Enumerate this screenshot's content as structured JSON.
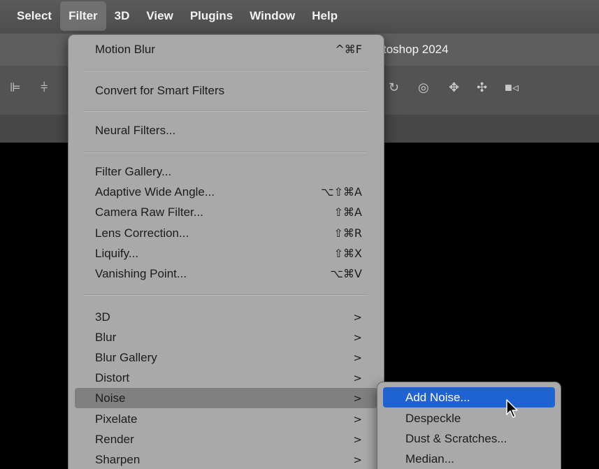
{
  "menubar": {
    "items": [
      "Select",
      "Filter",
      "3D",
      "View",
      "Plugins",
      "Window",
      "Help"
    ],
    "active": "Filter"
  },
  "app": {
    "title_fragment": "toshop 2024"
  },
  "filter_menu": {
    "motion_blur": {
      "label": "Motion Blur",
      "shortcut": "^⌘F"
    },
    "convert_smart": {
      "label": "Convert for Smart Filters"
    },
    "neural": {
      "label": "Neural Filters..."
    },
    "filter_gallery": {
      "label": "Filter Gallery..."
    },
    "adaptive_wide": {
      "label": "Adaptive Wide Angle...",
      "shortcut": "⌥⇧⌘A"
    },
    "camera_raw": {
      "label": "Camera Raw Filter...",
      "shortcut": "⇧⌘A"
    },
    "lens_correction": {
      "label": "Lens Correction...",
      "shortcut": "⇧⌘R"
    },
    "liquify": {
      "label": "Liquify...",
      "shortcut": "⇧⌘X"
    },
    "vanishing_point": {
      "label": "Vanishing Point...",
      "shortcut": "⌥⌘V"
    },
    "sub_3d": {
      "label": "3D"
    },
    "blur": {
      "label": "Blur"
    },
    "blur_gallery": {
      "label": "Blur Gallery"
    },
    "distort": {
      "label": "Distort"
    },
    "noise": {
      "label": "Noise"
    },
    "pixelate": {
      "label": "Pixelate"
    },
    "render": {
      "label": "Render"
    },
    "sharpen": {
      "label": "Sharpen"
    },
    "submenu_arrow": ">"
  },
  "noise_submenu": {
    "items": [
      "Add Noise...",
      "Despeckle",
      "Dust & Scratches...",
      "Median..."
    ],
    "selected": "Add Noise..."
  },
  "colors": {
    "menu_bg": "#a9a9a9",
    "highlight": "#808080",
    "selection": "#1f63d2"
  }
}
